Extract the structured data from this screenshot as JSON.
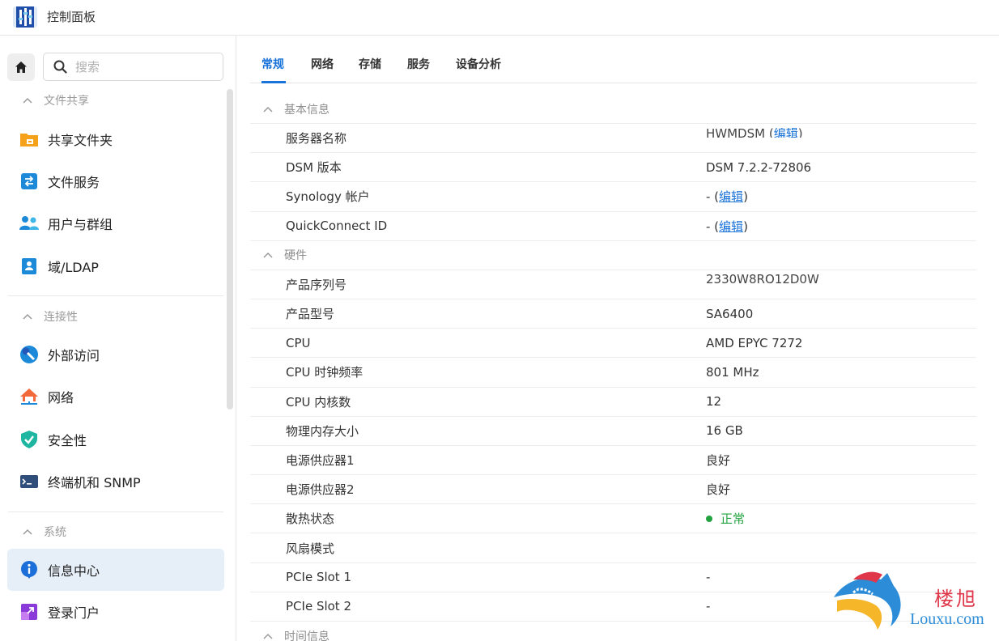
{
  "app": {
    "title": "控制面板"
  },
  "sidebar": {
    "search_placeholder": "搜索",
    "groups": [
      {
        "label": "文件共享",
        "items": [
          {
            "label": "共享文件夹",
            "icon": "shared-folder-icon"
          },
          {
            "label": "文件服务",
            "icon": "file-services-icon"
          },
          {
            "label": "用户与群组",
            "icon": "users-icon"
          },
          {
            "label": "域/LDAP",
            "icon": "domain-ldap-icon"
          }
        ]
      },
      {
        "label": "连接性",
        "items": [
          {
            "label": "外部访问",
            "icon": "external-access-icon"
          },
          {
            "label": "网络",
            "icon": "network-icon"
          },
          {
            "label": "安全性",
            "icon": "security-shield-icon"
          },
          {
            "label": "终端机和 SNMP",
            "icon": "terminal-icon"
          }
        ]
      },
      {
        "label": "系统",
        "items": [
          {
            "label": "信息中心",
            "icon": "info-center-icon",
            "active": true
          },
          {
            "label": "登录门户",
            "icon": "login-portal-icon"
          }
        ]
      }
    ]
  },
  "tabs": [
    {
      "label": "常规",
      "active": true
    },
    {
      "label": "网络"
    },
    {
      "label": "存储"
    },
    {
      "label": "服务"
    },
    {
      "label": "设备分析"
    }
  ],
  "sections": {
    "basic": {
      "label": "基本信息",
      "server_name": {
        "label": "服务器名称",
        "value_clipped": "HWMDSM",
        "edit": "编辑"
      },
      "dsm_version": {
        "label": "DSM 版本",
        "value": "DSM 7.2.2-72806"
      },
      "synology_account": {
        "label": "Synology 帐户",
        "value": "- (",
        "edit": "编辑",
        "close": ")"
      },
      "quickconnect": {
        "label": "QuickConnect ID",
        "value": "- (",
        "edit": "编辑",
        "close": ")"
      }
    },
    "hardware": {
      "label": "硬件",
      "serial": {
        "label": "产品序列号",
        "value_clipped": "2330W8RQ12D0W"
      },
      "model": {
        "label": "产品型号",
        "value": "SA6400"
      },
      "cpu": {
        "label": "CPU",
        "value": "AMD EPYC 7272"
      },
      "cpu_clock": {
        "label": "CPU 时钟频率",
        "value": "801 MHz"
      },
      "cpu_cores": {
        "label": "CPU 内核数",
        "value": "12"
      },
      "memory": {
        "label": "物理内存大小",
        "value": "16 GB"
      },
      "psu1": {
        "label": "电源供应器1",
        "value": "良好"
      },
      "psu2": {
        "label": "电源供应器2",
        "value": "良好"
      },
      "thermal": {
        "label": "散热状态",
        "value": "正常"
      },
      "fan_mode": {
        "label": "风扇模式",
        "value": ""
      },
      "pcie1": {
        "label": "PCIe Slot 1",
        "value": "-"
      },
      "pcie2": {
        "label": "PCIe Slot 2",
        "value": "-"
      }
    },
    "time": {
      "label": "时间信息"
    }
  },
  "watermark": {
    "cn": "楼旭",
    "en": "Louxu.com"
  },
  "colors": {
    "accent": "#1a73d8",
    "ok": "#22a33f",
    "active_bg": "#e6eef8"
  }
}
